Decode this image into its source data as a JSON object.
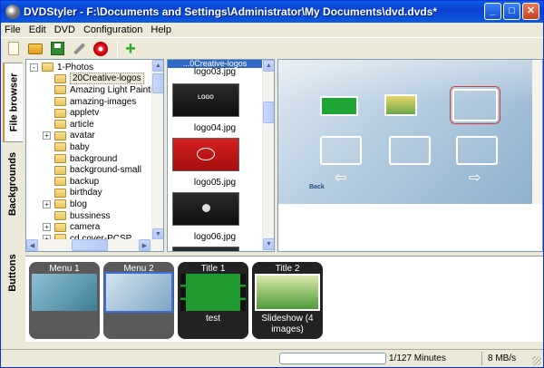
{
  "window": {
    "title": "DVDStyler - F:\\Documents and Settings\\Administrator\\My Documents\\dvd.dvds*",
    "minimize": "_",
    "maximize": "□",
    "close": "✕"
  },
  "menubar": {
    "items": [
      "File",
      "Edit",
      "DVD",
      "Configuration",
      "Help"
    ]
  },
  "toolbar": {
    "icons": [
      "new-file-icon",
      "open-folder-icon",
      "save-icon",
      "wrench-icon",
      "burn-disc-icon",
      "add-icon"
    ],
    "add_glyph": "+"
  },
  "side_tabs": {
    "file_browser": "File browser",
    "backgrounds": "Backgrounds",
    "buttons": "Buttons"
  },
  "file_tree": {
    "items": [
      {
        "label": "1-Photos",
        "expander": "-"
      },
      {
        "label": "20Creative-logos",
        "expander": ""
      },
      {
        "label": "Amazing Light Paintings",
        "expander": ""
      },
      {
        "label": "amazing-images",
        "expander": ""
      },
      {
        "label": "appletv",
        "expander": ""
      },
      {
        "label": "article",
        "expander": ""
      },
      {
        "label": "avatar",
        "expander": "+"
      },
      {
        "label": "baby",
        "expander": ""
      },
      {
        "label": "background",
        "expander": ""
      },
      {
        "label": "background-small",
        "expander": ""
      },
      {
        "label": "backup",
        "expander": ""
      },
      {
        "label": "birthday",
        "expander": ""
      },
      {
        "label": "blog",
        "expander": "+"
      },
      {
        "label": "bussiness",
        "expander": ""
      },
      {
        "label": "camera",
        "expander": "+"
      },
      {
        "label": "cd cover-PCSP",
        "expander": "+"
      }
    ],
    "scroll_up": "▲",
    "scroll_down": "▼",
    "scroll_left": "◀",
    "scroll_right": "▶"
  },
  "backgrounds": {
    "header": "...0Creative-logos",
    "items": [
      {
        "name": "logo03.jpg",
        "thumb_text": ""
      },
      {
        "name": "logo04.jpg",
        "thumb_text": "LOGO"
      },
      {
        "name": "logo05.jpg",
        "thumb_text": ""
      },
      {
        "name": "logo06.jpg",
        "thumb_text": ""
      }
    ]
  },
  "preview": {
    "back_label": "Back",
    "left_arrow": "⇦",
    "right_arrow": "⇨"
  },
  "cards": [
    {
      "title": "Menu 1",
      "subtitle": "",
      "kind": "menu"
    },
    {
      "title": "Menu 2",
      "subtitle": "",
      "kind": "menu"
    },
    {
      "title": "Title 1",
      "subtitle": "test",
      "kind": "title"
    },
    {
      "title": "Title 2",
      "subtitle": "Slideshow (4 images)",
      "kind": "title"
    }
  ],
  "status": {
    "minutes": "1/127 Minutes",
    "rate": "8 MB/s"
  }
}
